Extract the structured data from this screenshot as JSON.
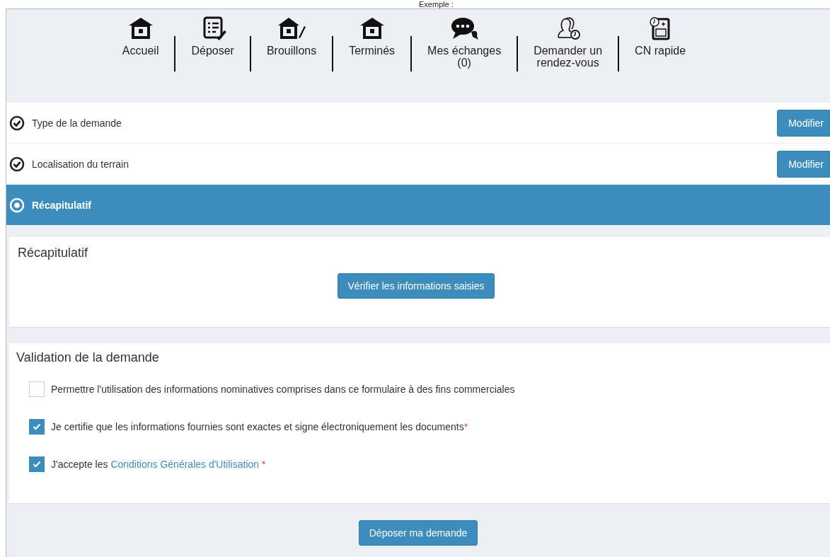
{
  "caption": "Exemple :",
  "nav": [
    {
      "label": "Accueil",
      "kind": "home"
    },
    {
      "label": "Déposer",
      "kind": "form"
    },
    {
      "label": "Brouillons",
      "kind": "draft"
    },
    {
      "label": "Terminés",
      "kind": "home"
    },
    {
      "label": "Mes échanges\n(0)",
      "kind": "chat"
    },
    {
      "label": "Demander un\nrendez-vous",
      "kind": "meeting"
    },
    {
      "label": "CN rapide",
      "kind": "cn"
    }
  ],
  "steps": [
    {
      "label": "Type de la demande",
      "completed": true,
      "selected": false,
      "action": "Modifier"
    },
    {
      "label": "Localisation du terrain",
      "completed": true,
      "selected": false,
      "action": "Modifier"
    },
    {
      "label": "Récapitulatif",
      "completed": false,
      "selected": true
    }
  ],
  "summary": {
    "title": "Récapitulatif",
    "button": "Vérifier les informations saisies"
  },
  "validation": {
    "title": "Validation de la demande",
    "checks": [
      {
        "label": "Permettre l'utilisation des informations nominatives comprises dans ce formulaire à des fins commerciales",
        "checked": false
      },
      {
        "label": "Je certifie que les informations fournies sont exactes et signe électroniquement les documents",
        "checked": true,
        "mark": "*"
      },
      {
        "label": "J'accepte les",
        "link": "Conditions Générales d'Utilisation",
        "checked": true,
        "mark": "*"
      }
    ]
  },
  "submit": "Déposer ma demande"
}
